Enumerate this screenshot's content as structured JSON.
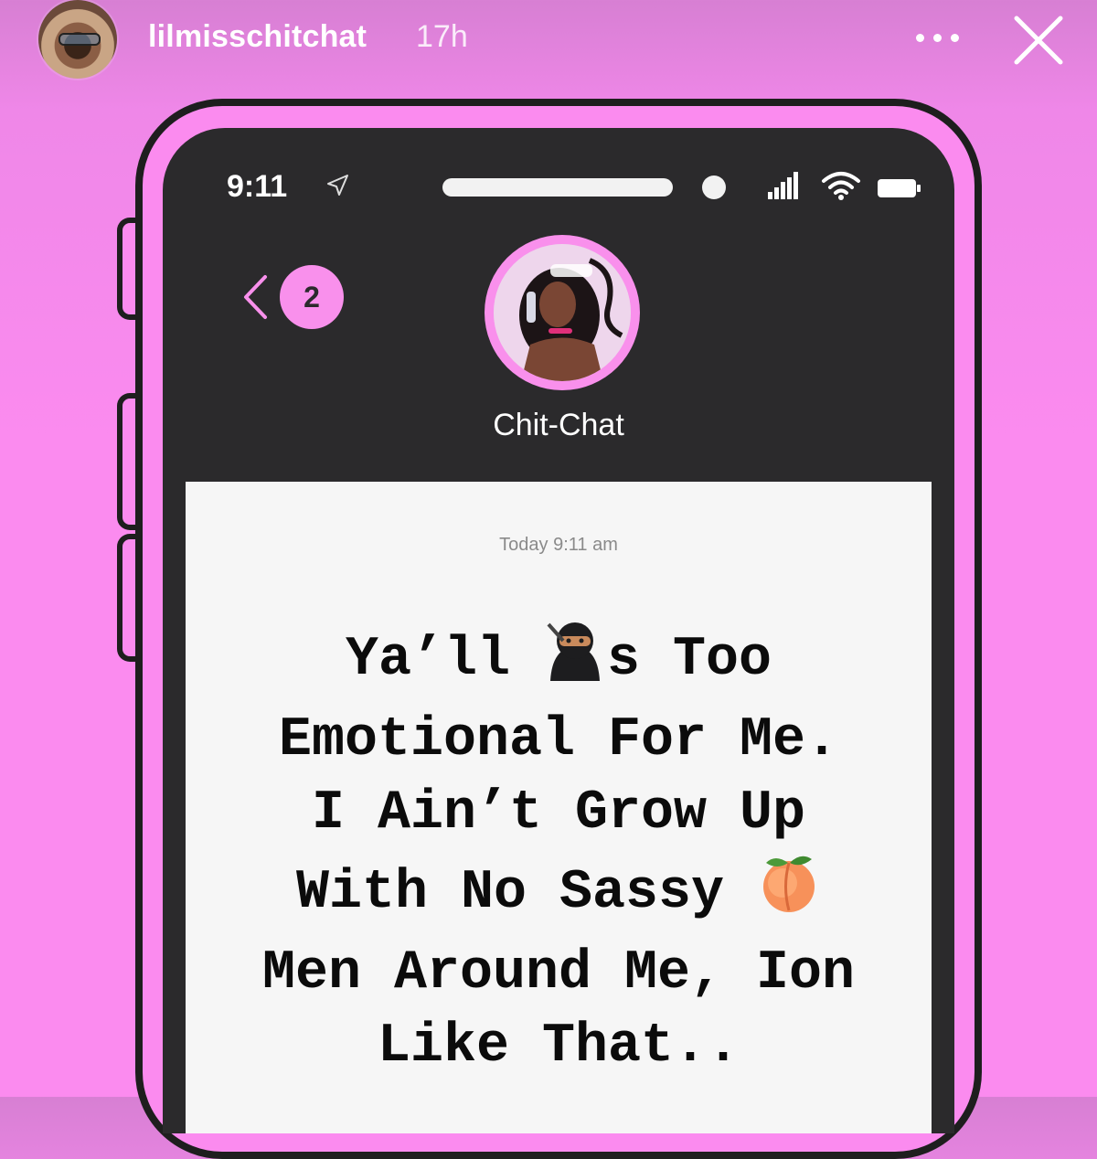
{
  "story": {
    "username": "lilmisschitchat",
    "time_ago": "17h",
    "more_icon": "more-dots-icon",
    "close_icon": "close-x-icon"
  },
  "phone": {
    "status_bar": {
      "time": "9:11"
    },
    "chat": {
      "unread_count": "2",
      "contact_name": "Chit-Chat",
      "message_timestamp": "Today 9:11 am",
      "message_lines": [
        "Ya’ll ",
        "s Too",
        "Emotional For Me.",
        "I Ain’t Grow Up",
        "With No Sassy ",
        "Men Around Me, Ion",
        "Like That.."
      ],
      "emoji_1": "ninja-emoji",
      "emoji_2": "peach-emoji"
    }
  },
  "colors": {
    "background_pink": "#fb8bef",
    "accent_pink": "#f990ec",
    "screen_dark": "#2b2a2c"
  }
}
